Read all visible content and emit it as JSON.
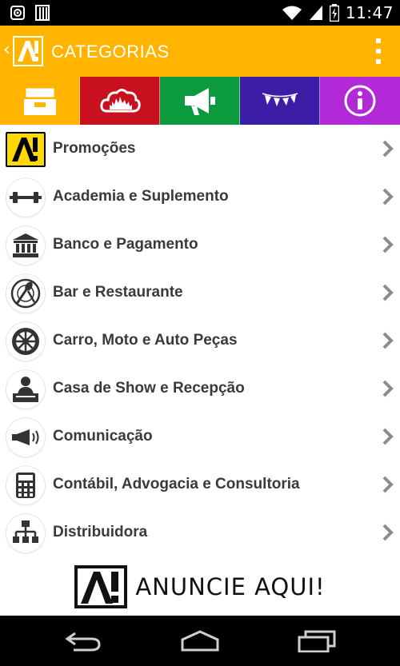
{
  "statusbar": {
    "time": "11:47"
  },
  "appbar": {
    "title": "CATEGORIAS"
  },
  "tabs": [
    {
      "name": "categorias",
      "color": "#FFB400",
      "icon": "file-box-icon"
    },
    {
      "name": "eventos",
      "color": "#C8101E",
      "icon": "cloud-crowd-icon"
    },
    {
      "name": "anuncios",
      "color": "#0B9A3E",
      "icon": "megaphone-icon"
    },
    {
      "name": "festas",
      "color": "#3B1DA6",
      "icon": "bunting-icon"
    },
    {
      "name": "informacoes",
      "color": "#B22AD8",
      "icon": "info-icon"
    }
  ],
  "categories": [
    {
      "label": "Promoções",
      "icon": "brand-logo-icon"
    },
    {
      "label": "Academia e Suplemento",
      "icon": "dumbbell-icon"
    },
    {
      "label": "Banco e Pagamento",
      "icon": "bank-icon"
    },
    {
      "label": "Bar e Restaurante",
      "icon": "plate-cutlery-icon"
    },
    {
      "label": "Carro, Moto e Auto Peças",
      "icon": "wheel-icon"
    },
    {
      "label": "Casa de Show e Recepção",
      "icon": "dj-icon"
    },
    {
      "label": "Comunicação",
      "icon": "megaphone-icon"
    },
    {
      "label": "Contábil, Advogacia e Consultoria",
      "icon": "calculator-icon"
    },
    {
      "label": "Distribuidora",
      "icon": "network-icon"
    }
  ],
  "banner": {
    "text": "ANUNCIE AQUI!"
  },
  "colors": {
    "accent": "#FFB400",
    "text": "#3a3a3a",
    "chevron": "#8c8c8c"
  }
}
